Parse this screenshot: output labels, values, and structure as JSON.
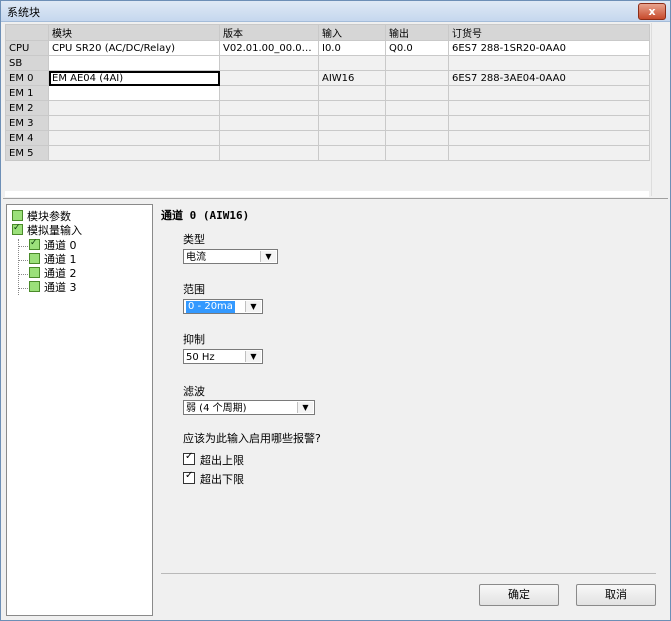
{
  "window": {
    "title": "系统块",
    "close_label": "x"
  },
  "table": {
    "headers": [
      "",
      "模块",
      "版本",
      "输入",
      "输出",
      "订货号"
    ],
    "rows": [
      {
        "slot": "CPU",
        "module": "CPU SR20 (AC/DC/Relay)",
        "version": "V02.01.00_00.00...",
        "input": "I0.0",
        "output": "Q0.0",
        "order": "6ES7 288-1SR20-0AA0"
      },
      {
        "slot": "SB",
        "module": "",
        "version": "",
        "input": "",
        "output": "",
        "order": ""
      },
      {
        "slot": "EM 0",
        "module": "EM AE04 (4AI)",
        "version": "",
        "input": "AIW16",
        "output": "",
        "order": "6ES7 288-3AE04-0AA0"
      },
      {
        "slot": "EM 1",
        "module": "",
        "version": "",
        "input": "",
        "output": "",
        "order": ""
      },
      {
        "slot": "EM 2",
        "module": "",
        "version": "",
        "input": "",
        "output": "",
        "order": ""
      },
      {
        "slot": "EM 3",
        "module": "",
        "version": "",
        "input": "",
        "output": "",
        "order": ""
      },
      {
        "slot": "EM 4",
        "module": "",
        "version": "",
        "input": "",
        "output": "",
        "order": ""
      },
      {
        "slot": "EM 5",
        "module": "",
        "version": "",
        "input": "",
        "output": "",
        "order": ""
      }
    ]
  },
  "tree": {
    "items": [
      {
        "label": "模块参数"
      },
      {
        "label": "模拟量输入"
      },
      {
        "label": "通道 0"
      },
      {
        "label": "通道 1"
      },
      {
        "label": "通道 2"
      },
      {
        "label": "通道 3"
      }
    ]
  },
  "panel": {
    "channel_title": "通道 0 (AIW16)",
    "type_label": "类型",
    "type_value": "电流",
    "range_label": "范围",
    "range_value": "0 - 20ma",
    "reject_label": "抑制",
    "reject_value": "50 Hz",
    "filter_label": "滤波",
    "filter_value": "弱 (4 个周期)",
    "alarm_question": "应该为此输入启用哪些报警?",
    "alarm_upper": "超出上限",
    "alarm_lower": "超出下限"
  },
  "buttons": {
    "ok": "确定",
    "cancel": "取消"
  }
}
